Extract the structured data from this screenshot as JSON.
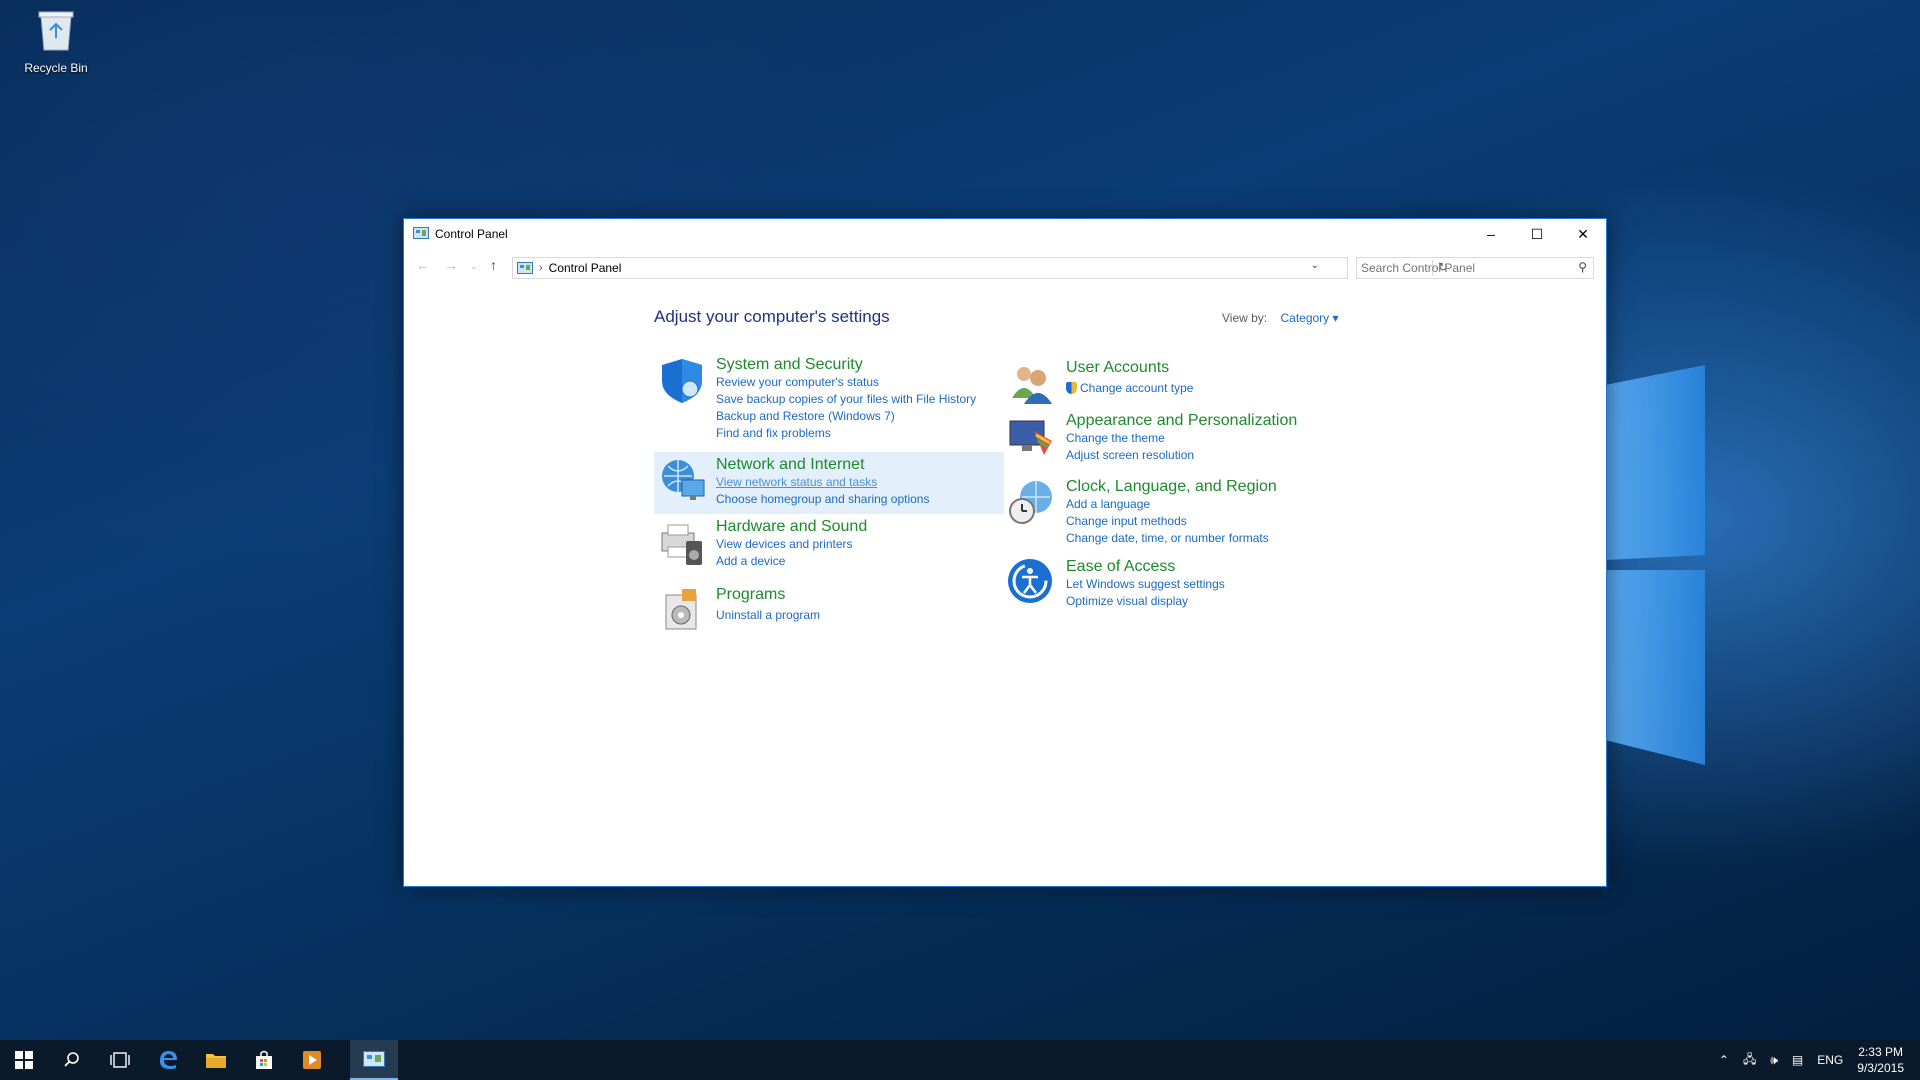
{
  "desktop": {
    "recycle_bin_label": "Recycle Bin"
  },
  "window": {
    "title": "Control Panel",
    "address": {
      "crumb": "Control Panel"
    },
    "search_placeholder": "Search Control Panel",
    "heading": "Adjust your computer's settings",
    "view_by_label": "View by:",
    "view_by_value": "Category"
  },
  "categories_left": [
    {
      "title": "System and Security",
      "icon": "shield-icon",
      "links": [
        "Review your computer's status",
        "Save backup copies of your files with File History",
        "Backup and Restore (Windows 7)",
        "Find and fix problems"
      ]
    },
    {
      "title": "Network and Internet",
      "icon": "network-globe-icon",
      "links": [
        "View network status and tasks",
        "Choose homegroup and sharing options"
      ]
    },
    {
      "title": "Hardware and Sound",
      "icon": "printer-speaker-icon",
      "links": [
        "View devices and printers",
        "Add a device"
      ]
    },
    {
      "title": "Programs",
      "icon": "programs-disc-icon",
      "links": [
        "Uninstall a program"
      ]
    }
  ],
  "categories_right": [
    {
      "title": "User Accounts",
      "icon": "users-icon",
      "links": [
        "Change account type"
      ]
    },
    {
      "title": "Appearance and Personalization",
      "icon": "monitor-palette-icon",
      "links": [
        "Change the theme",
        "Adjust screen resolution"
      ]
    },
    {
      "title": "Clock, Language, and Region",
      "icon": "clock-globe-icon",
      "links": [
        "Add a language",
        "Change input methods",
        "Change date, time, or number formats"
      ]
    },
    {
      "title": "Ease of Access",
      "icon": "ease-of-access-icon",
      "links": [
        "Let Windows suggest settings",
        "Optimize visual display"
      ]
    }
  ],
  "taskbar": {
    "tray_lang": "ENG",
    "time": "2:33 PM",
    "date": "9/3/2015"
  }
}
